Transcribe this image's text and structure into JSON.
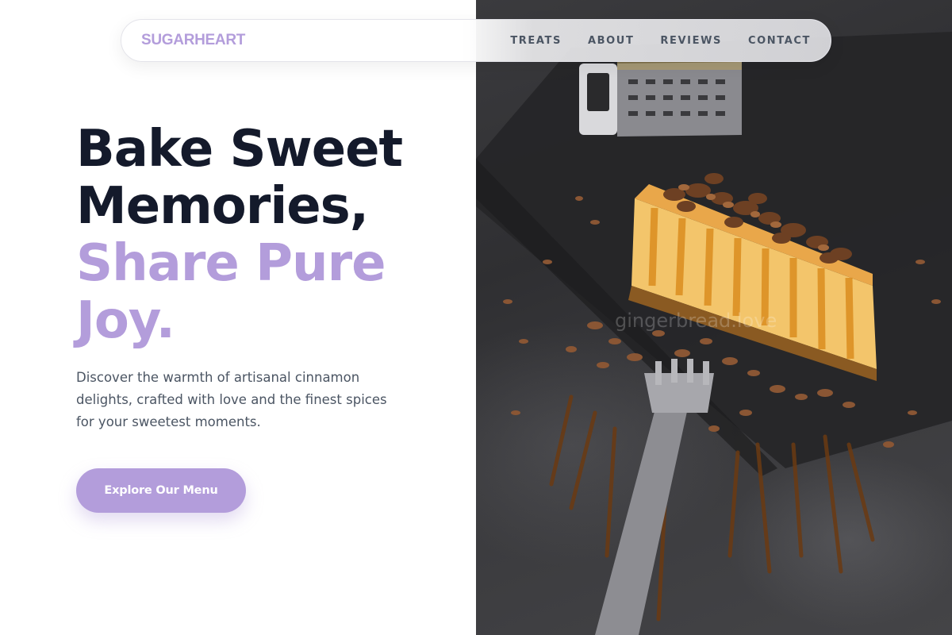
{
  "brand": {
    "name": "SUGARHEART"
  },
  "nav": {
    "items": [
      {
        "label": "TREATS"
      },
      {
        "label": "ABOUT"
      },
      {
        "label": "REVIEWS"
      },
      {
        "label": "CONTACT"
      }
    ]
  },
  "hero": {
    "headline_dark": [
      "Bake Sweet",
      "Memories,"
    ],
    "headline_accent": [
      "Share Pure",
      "Joy."
    ],
    "description": "Discover the warmth of artisanal cinnamon delights, crafted with love and the finest spices for your sweetest moments.",
    "cta_label": "Explore Our Menu"
  },
  "photo": {
    "subject": "cheesecake-slice-with-caramel-and-chocolate-shavings",
    "watermark": "gingerbread.love"
  },
  "colors": {
    "accent": "#b39ddb",
    "heading": "#141a2b",
    "body_text": "#4b5563",
    "background": "#ffffff"
  }
}
